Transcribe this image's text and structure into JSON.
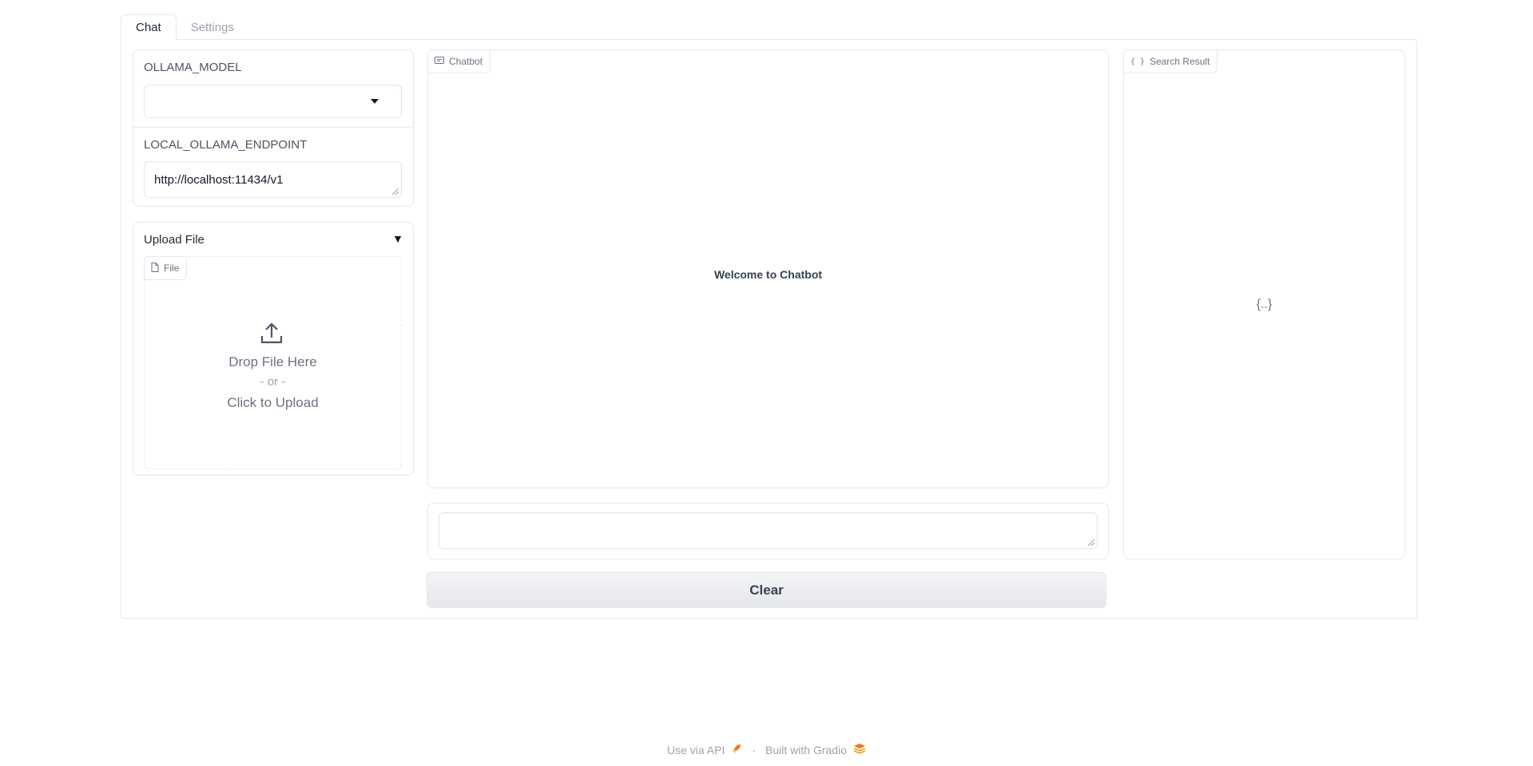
{
  "tabs": [
    {
      "label": "Chat",
      "active": true
    },
    {
      "label": "Settings",
      "active": false
    }
  ],
  "settings_panel": {
    "model_label": "OLLAMA_MODEL",
    "model_value": "",
    "endpoint_label": "LOCAL_OLLAMA_ENDPOINT",
    "endpoint_value": "http://localhost:11434/v1"
  },
  "upload": {
    "title": "Upload File",
    "component_label": "File",
    "drop_text": "Drop File Here",
    "or_text": "- or -",
    "click_text": "Click to Upload"
  },
  "chatbot": {
    "label": "Chatbot",
    "welcome": "Welcome to Chatbot"
  },
  "message_input": {
    "value": ""
  },
  "search_result": {
    "label": "Search Result",
    "empty_symbol": "{..}"
  },
  "clear_button": "Clear",
  "footer": {
    "api_link": "Use via API",
    "separator": "·",
    "built_with": "Built with Gradio"
  },
  "colors": {
    "border": "#e5e7eb",
    "text": "#374151",
    "muted": "#9ca3af"
  }
}
